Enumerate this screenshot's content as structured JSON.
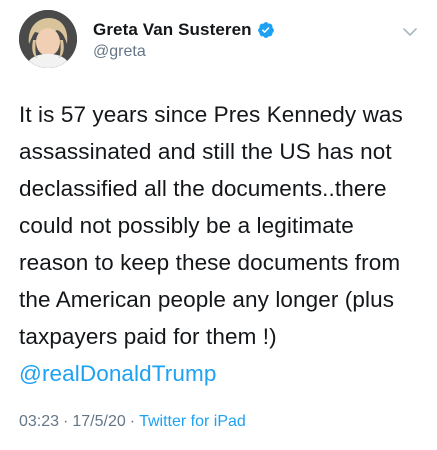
{
  "author": {
    "name": "Greta Van Susteren",
    "handle": "@greta",
    "verified_icon": "verified-badge-icon",
    "avatar_icon": "profile-avatar"
  },
  "menu": {
    "icon": "chevron-down-icon"
  },
  "tweet": {
    "text": "It is 57 years since Pres Kennedy was assassinated and still the US has not declassified all the documents..there could not possibly be a legitimate reason to keep these documents from the American people any longer (plus taxpayers paid for them !) ",
    "mention": "@realDonaldTrump"
  },
  "meta": {
    "time": "03:23",
    "sep1": "·",
    "date": "17/5/20",
    "sep2": "·",
    "source": "Twitter for iPad"
  },
  "colors": {
    "accent": "#1da1f2",
    "secondary_text": "#657786",
    "primary_text": "#14171a"
  }
}
